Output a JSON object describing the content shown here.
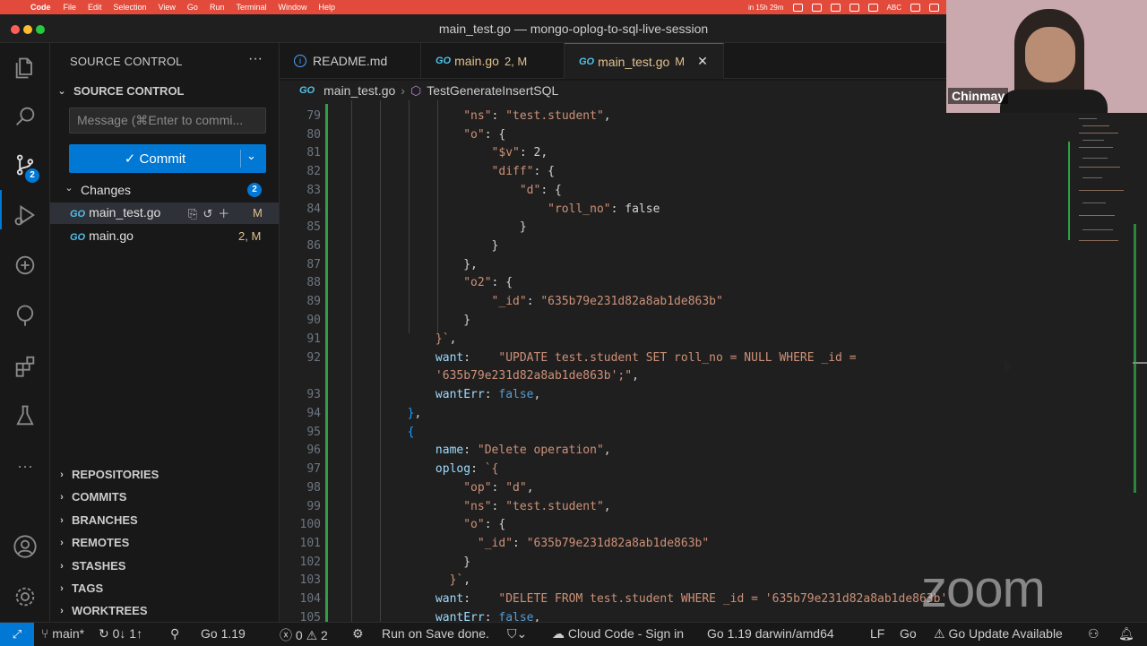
{
  "menubar": {
    "app": "Code",
    "items": [
      "File",
      "Edit",
      "Selection",
      "View",
      "Go",
      "Run",
      "Terminal",
      "Window",
      "Help"
    ],
    "tray_time": "in 15h 29m",
    "tray_input": "ABC"
  },
  "window": {
    "title": "main_test.go — mongo-oplog-to-sql-live-session"
  },
  "activity": {
    "scm_badge": "2",
    "more": "···"
  },
  "sidebar": {
    "title": "SOURCE CONTROL",
    "section": "SOURCE CONTROL",
    "message_placeholder": "Message (⌘Enter to commi...",
    "commit_label": "✓ Commit",
    "changes_label": "Changes",
    "changes_count": "2",
    "files": [
      {
        "name": "main_test.go",
        "status": "M"
      },
      {
        "name": "main.go",
        "status": "2, M"
      }
    ],
    "collapsed_sections": [
      "REPOSITORIES",
      "COMMITS",
      "BRANCHES",
      "REMOTES",
      "STASHES",
      "TAGS",
      "WORKTREES"
    ]
  },
  "tabs": [
    {
      "name": "README.md",
      "status": ""
    },
    {
      "name": "main.go",
      "status": "2, M"
    },
    {
      "name": "main_test.go",
      "status": "M"
    }
  ],
  "breadcrumb": {
    "file": "main_test.go",
    "symbol": "TestGenerateInsertSQL"
  },
  "editor": {
    "line_numbers": [
      "79",
      "80",
      "81",
      "82",
      "83",
      "84",
      "85",
      "86",
      "87",
      "88",
      "89",
      "90",
      "91",
      "92",
      "",
      "93",
      "94",
      "95",
      "96",
      "97",
      "98",
      "99",
      "100",
      "101",
      "102",
      "103",
      "104",
      "105"
    ]
  },
  "video": {
    "participant": "Chinmay",
    "watermark": "zoom"
  },
  "statusbar": {
    "branch": "main*",
    "sync": "0↓ 1↑",
    "go_version": "Go 1.19",
    "errors": "0",
    "warnings": "2",
    "run_on_save": "Run on Save done.",
    "cloud_code": "Cloud Code - Sign in",
    "go_env": "Go 1.19 darwin/amd64",
    "eol": "LF",
    "language": "Go",
    "update": "Go Update Available"
  }
}
